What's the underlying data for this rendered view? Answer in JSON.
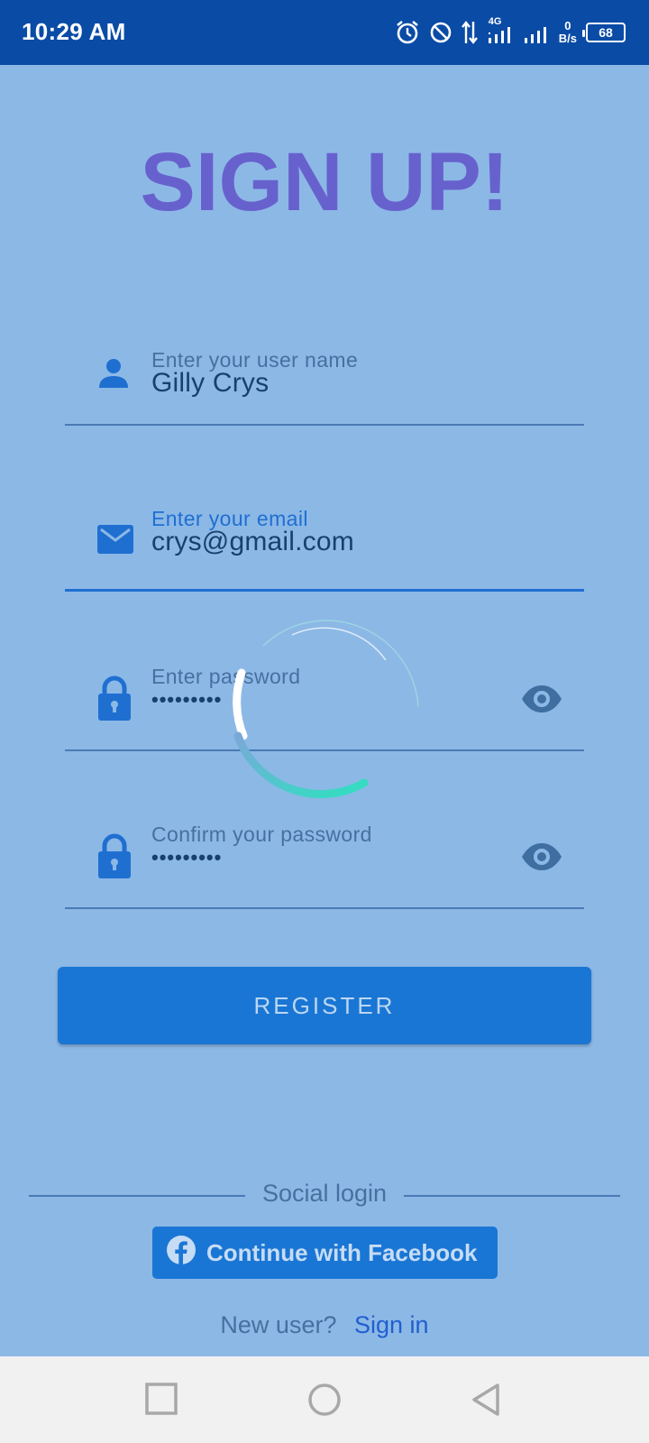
{
  "status_bar": {
    "time": "10:29 AM",
    "network_type": "4G",
    "net_speed_value": "0",
    "net_speed_unit": "B/s",
    "battery": "68"
  },
  "page": {
    "title": "SIGN UP!"
  },
  "form": {
    "username": {
      "label": "Enter your user name",
      "value": "Gilly Crys"
    },
    "email": {
      "label": "Enter your email",
      "value": "crys@gmail.com"
    },
    "password": {
      "label": "Enter password",
      "value": "•••••••••"
    },
    "confirm_password": {
      "label": "Confirm your password",
      "value": "•••••••••"
    },
    "register_label": "REGISTER"
  },
  "social": {
    "divider_label": "Social login",
    "facebook_label": "Continue with Facebook"
  },
  "footer": {
    "question": "New user?",
    "link": "Sign in"
  },
  "colors": {
    "background": "#8cb8e6",
    "status_bar": "#0a4ba6",
    "title": "#6761cd",
    "accent": "#1a76d4"
  },
  "icons": [
    "alarm-icon",
    "dnd-icon",
    "data-arrows-icon",
    "signal-icon",
    "battery-icon",
    "person-icon",
    "mail-icon",
    "lock-icon",
    "eye-icon",
    "facebook-icon",
    "square-nav-icon",
    "circle-nav-icon",
    "back-triangle-icon"
  ]
}
